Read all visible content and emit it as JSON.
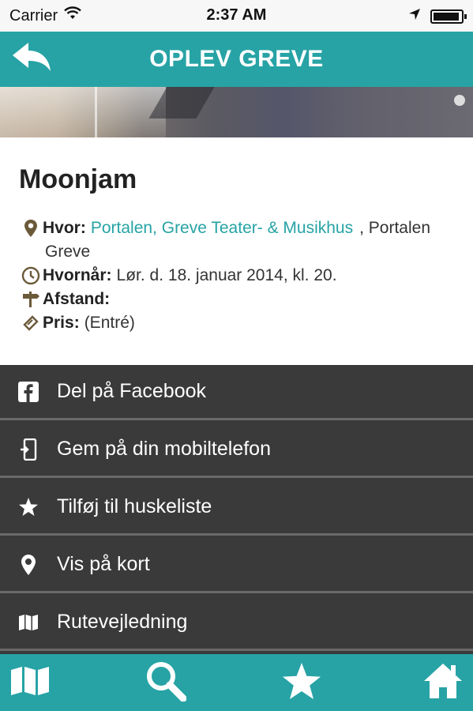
{
  "status_bar": {
    "carrier": "Carrier",
    "time": "2:37 AM",
    "icons": [
      "wifi-icon",
      "location-arrow-icon",
      "battery-icon"
    ]
  },
  "header": {
    "title": "OPLEV GREVE",
    "back_icon": "back-arrow-icon"
  },
  "event": {
    "title": "Moonjam",
    "where_label": "Hvor:",
    "where_link": "Portalen, Greve Teater- & Musikhus",
    "where_rest": ", Portalen",
    "where_city": "Greve",
    "when_label": "Hvornår:",
    "when_value": "Lør. d. 18. januar 2014, kl. 20.",
    "distance_label": "Afstand:",
    "price_label": "Pris:",
    "price_value": "(Entré)"
  },
  "actions": [
    {
      "label": "Del på Facebook",
      "icon": "facebook-icon"
    },
    {
      "label": "Gem på din mobiltelefon",
      "icon": "save-to-phone-icon"
    },
    {
      "label": "Tilføj til huskeliste",
      "icon": "star-icon"
    },
    {
      "label": "Vis på kort",
      "icon": "map-pin-icon"
    },
    {
      "label": "Rutevejledning",
      "icon": "route-map-icon"
    }
  ],
  "tabbar": {
    "tabs": [
      "map-icon",
      "search-icon",
      "star-icon",
      "home-icon"
    ]
  },
  "colors": {
    "accent": "#27a3a5",
    "list_bg": "#3a3a3a",
    "icon_brown": "#6b5a3a"
  }
}
